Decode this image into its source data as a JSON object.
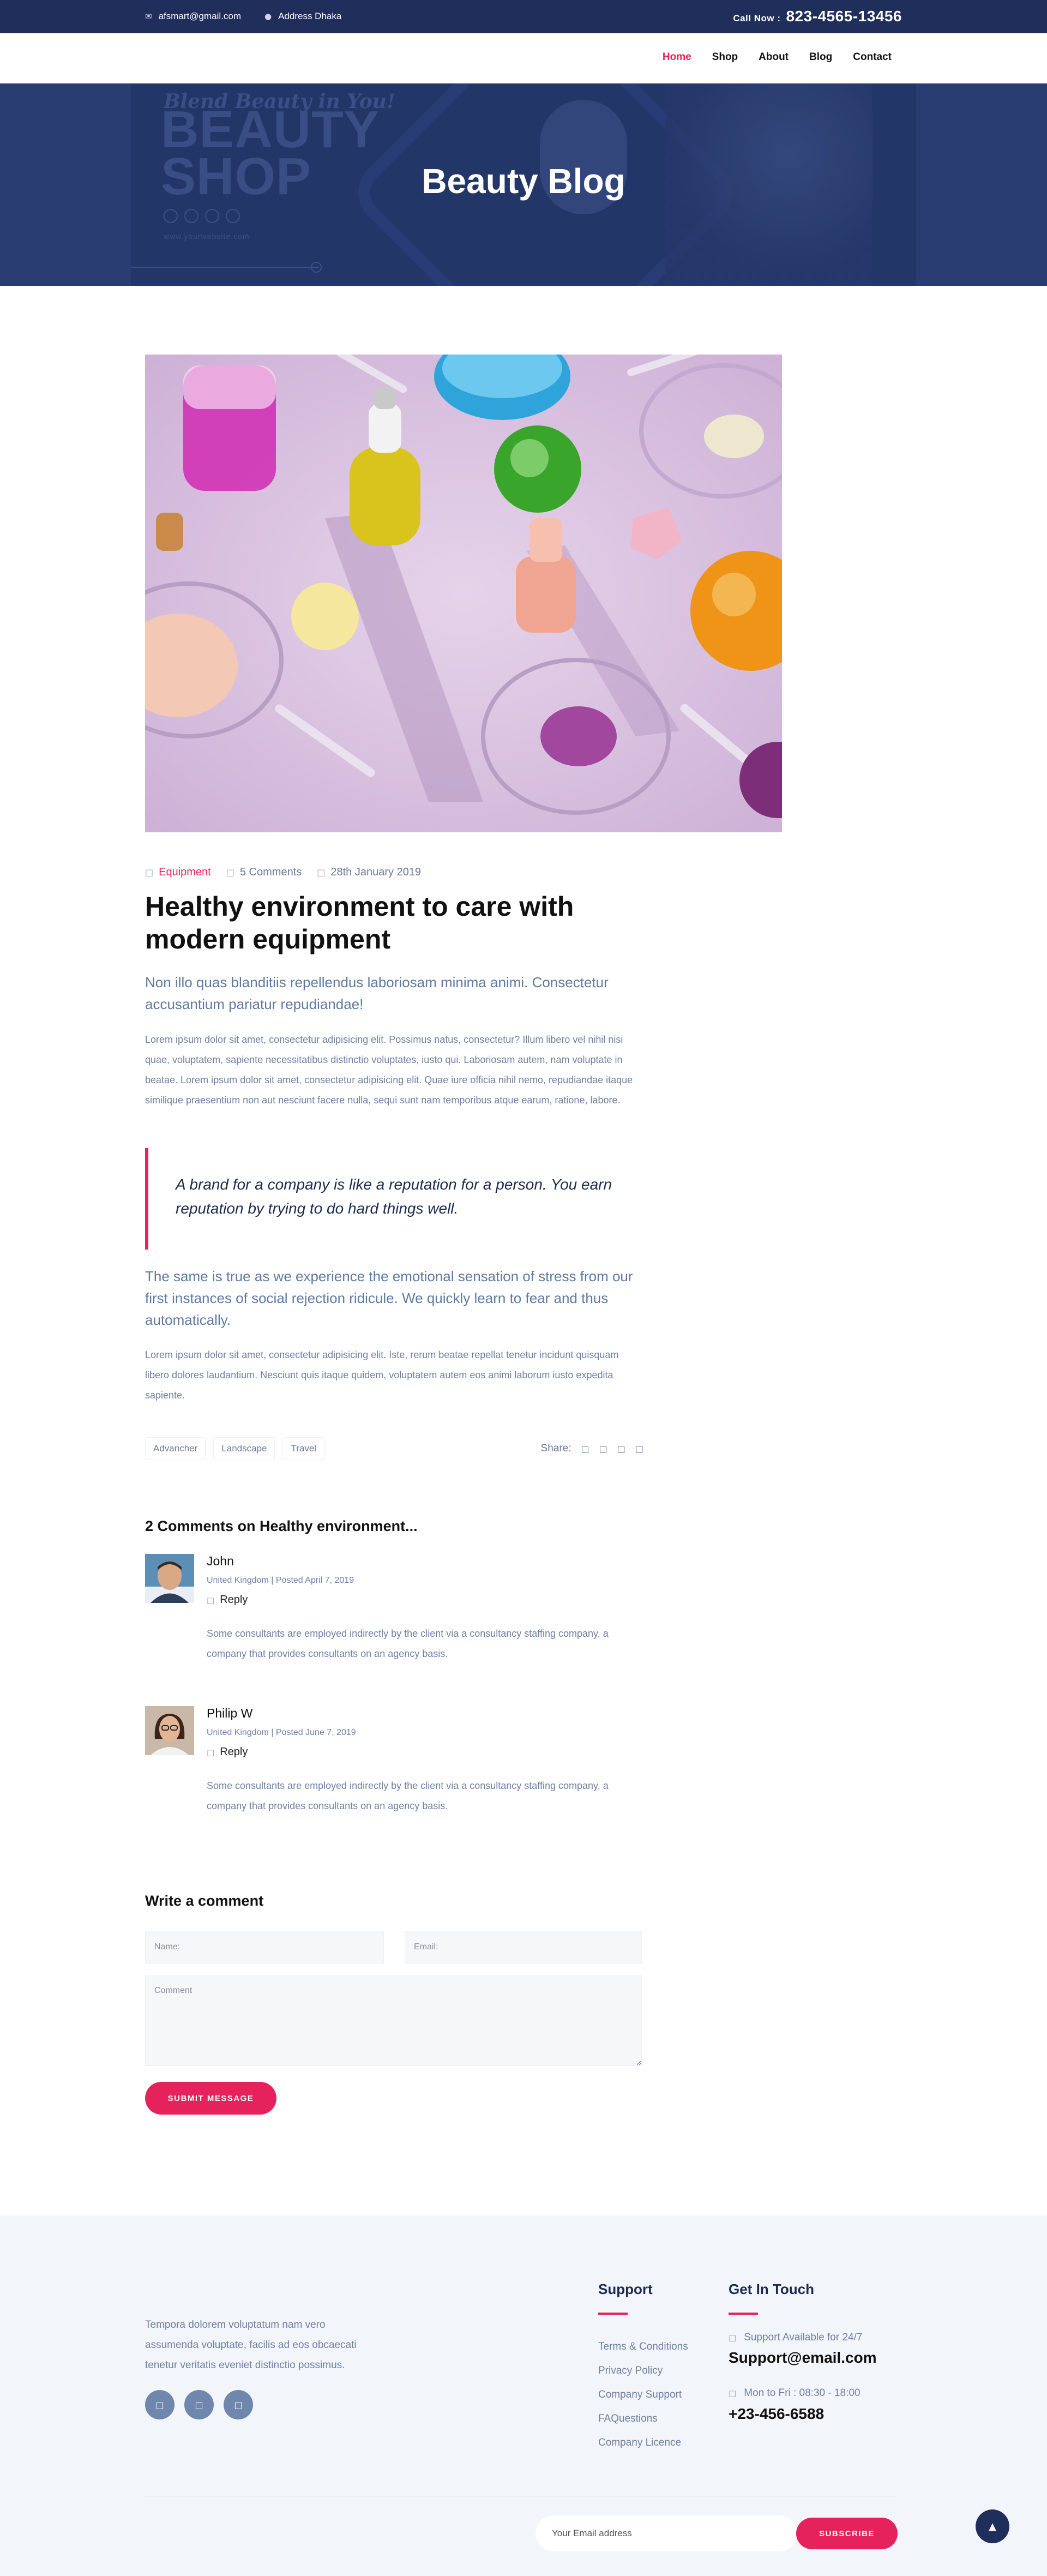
{
  "topbar": {
    "email": "afsmart@gmail.com",
    "address": "Address Dhaka",
    "call_label": "Call Now :",
    "phone": "823-4565-13456",
    "email_icon": "envelope-icon",
    "address_icon": "map-marker-icon"
  },
  "nav": {
    "items": [
      {
        "label": "Home",
        "active": true
      },
      {
        "label": "Shop"
      },
      {
        "label": "About"
      },
      {
        "label": "Blog"
      },
      {
        "label": "Contact"
      }
    ]
  },
  "hero": {
    "title": "Beauty Blog",
    "bg_tagline": "Blend Beauty in You!",
    "bg_heading_1": "BEAUTY",
    "bg_heading_2": "SHOP",
    "bg_url": "www.yourwebsite.com"
  },
  "post": {
    "category": "Equipment",
    "comments": "5 Comments",
    "date": "28th January 2019",
    "title": "Healthy environment to care with modern equipment",
    "lead": "Non illo quas blanditiis repellendus laboriosam minima animi. Consectetur accusantium pariatur repudiandae!",
    "body1": "Lorem ipsum dolor sit amet, consectetur adipisicing elit. Possimus natus, consectetur? Illum libero vel nihil nisi quae, voluptatem, sapiente necessitatibus distinctio voluptates, iusto qui. Laboriosam autem, nam voluptate in beatae. Lorem ipsum dolor sit amet, consectetur adipisicing elit. Quae iure officia nihil nemo, repudiandae itaque similique praesentium non aut nesciunt facere nulla, sequi sunt nam temporibus atque earum, ratione, labore.",
    "quote": "A brand for a company is like a reputation for a person. You earn reputation by trying to do hard things well.",
    "lead2": "The same is true as we experience the emotional sensation of stress from our first instances of social rejection ridicule. We quickly learn to fear and thus automatically.",
    "body2": "Lorem ipsum dolor sit amet, consectetur adipisicing elit. Iste, rerum beatae repellat tenetur incidunt quisquam libero dolores laudantium. Nesciunt quis itaque quidem, voluptatem autem eos animi laborum iusto expedita sapiente.",
    "tags": [
      "Advancher",
      "Landscape",
      "Travel"
    ],
    "share_label": "Share:",
    "share_icons": [
      "facebook-icon",
      "twitter-icon",
      "google-plus-icon",
      "pinterest-icon"
    ]
  },
  "comments": {
    "title": "2 Comments on Healthy environment...",
    "items": [
      {
        "name": "John",
        "info": "United Kingdom | Posted April 7, 2019",
        "reply": "Reply",
        "text": "Some consultants are employed indirectly by the client via a consultancy staffing company, a company that provides consultants on an agency basis."
      },
      {
        "name": "Philip W",
        "info": "United Kingdom | Posted June 7, 2019",
        "reply": "Reply",
        "text": "Some consultants are employed indirectly by the client via a consultancy staffing company, a company that provides consultants on an agency basis."
      }
    ]
  },
  "form": {
    "title": "Write a comment",
    "name_placeholder": "Name:",
    "email_placeholder": "Email:",
    "comment_placeholder": "Comment",
    "submit": "SUBMIT MESSAGE"
  },
  "footer": {
    "about": "Tempora dolorem voluptatum nam vero assumenda voluptate, facilis ad eos obcaecati tenetur veritatis eveniet distinctio possimus.",
    "social_icons": [
      "facebook-icon",
      "twitter-icon",
      "instagram-icon"
    ],
    "support_title": "Support",
    "support_links": [
      "Terms & Conditions",
      "Privacy Policy",
      "Company Support",
      "FAQuestions",
      "Company Licence"
    ],
    "contact_title": "Get In Touch",
    "support_available": "Support Available for 24/7",
    "support_email": "Support@email.com",
    "hours": "Mon to Fri : 08:30 - 18:00",
    "phone": "+23-456-6588",
    "newsletter_placeholder": "Your Email address",
    "subscribe": "SUBSCRIBE"
  },
  "colors": {
    "primary": "#1f2e5b",
    "accent": "#e5225c",
    "text_muted": "#6f80a3",
    "footer_bg": "#f2f5f9"
  }
}
